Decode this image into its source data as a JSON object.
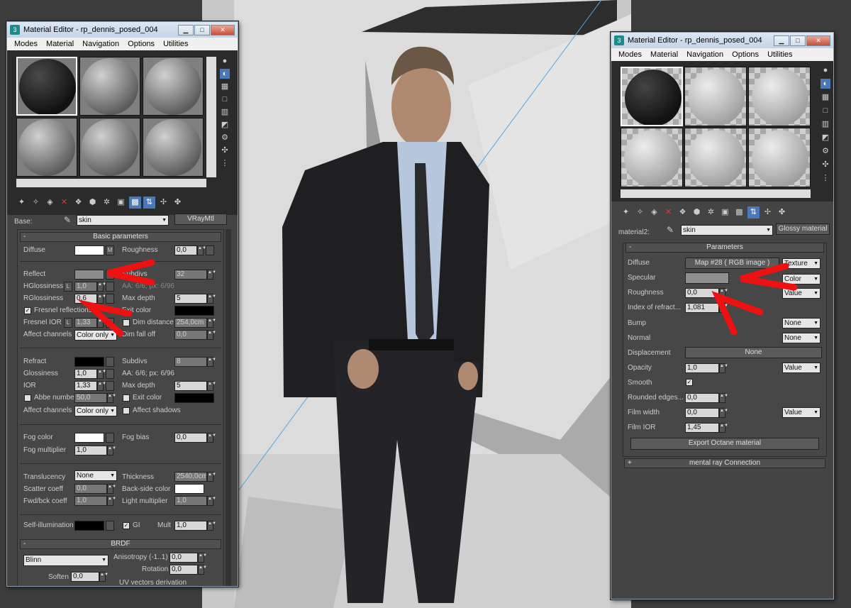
{
  "left_editor": {
    "title": "Material Editor - rp_dennis_posed_004",
    "menu": [
      "Modes",
      "Material",
      "Navigation",
      "Options",
      "Utilities"
    ],
    "base_label": "Base:",
    "material_name": "skin",
    "material_type": "VRayMtl",
    "basic_header": "Basic parameters",
    "diffuse": {
      "label": "Diffuse",
      "map": "M",
      "roughness_label": "Roughness",
      "roughness": "0,0"
    },
    "reflect": {
      "label": "Reflect",
      "subdivs_label": "Subdivs",
      "subdivs": "32",
      "hglossiness_label": "HGlossiness",
      "hglossiness": "1,0",
      "lock": "L",
      "aa": "AA: 6/6; px: 6/96",
      "rglossiness_label": "RGlossiness",
      "rglossiness": "0,6",
      "max_depth_label": "Max depth",
      "max_depth": "5",
      "fresnel_label": "Fresnel reflections",
      "exit_color_label": "Exit color",
      "fresnel_ior_label": "Fresnel IOR",
      "fresnel_ior": "1,33",
      "dim_distance_label": "Dim distance",
      "dim_distance": "254,0cm",
      "affect_channels_label": "Affect channels",
      "affect_channels": "Color only",
      "dim_falloff_label": "Dim fall off",
      "dim_falloff": "0,0"
    },
    "refract": {
      "label": "Refract",
      "subdivs_label": "Subdivs",
      "subdivs": "8",
      "glossiness_label": "Glossiness",
      "glossiness": "1,0",
      "aa": "AA: 6/6; px: 6/96",
      "ior_label": "IOR",
      "ior": "1,33",
      "max_depth_label": "Max depth",
      "max_depth": "5",
      "abbe_label": "Abbe number",
      "abbe": "50,0",
      "exit_color_label": "Exit color",
      "affect_channels_label": "Affect channels",
      "affect_channels": "Color only",
      "affect_shadows_label": "Affect shadows"
    },
    "fog": {
      "color_label": "Fog color",
      "bias_label": "Fog bias",
      "bias": "0,0",
      "multiplier_label": "Fog multiplier",
      "multiplier": "1,0"
    },
    "translucency": {
      "label": "Translucency",
      "value": "None",
      "thickness_label": "Thickness",
      "thickness": "2540,0cm",
      "scatter_label": "Scatter coeff",
      "scatter": "0,0",
      "backside_label": "Back-side color",
      "fwdbck_label": "Fwd/bck coeff",
      "fwdbck": "1,0",
      "light_mult_label": "Light multiplier",
      "light_mult": "1,0"
    },
    "selfillum": {
      "label": "Self-illumination",
      "gi_label": "GI",
      "mult_label": "Mult",
      "mult": "1,0"
    },
    "brdf": {
      "header": "BRDF",
      "type": "Blinn",
      "anisotropy_label": "Anisotropy (-1..1)",
      "anisotropy": "0,0",
      "rotation_label": "Rotation",
      "rotation": "0,0",
      "soften_label": "Soften",
      "soften": "0,0",
      "uv_label": "UV vectors derivation"
    }
  },
  "right_editor": {
    "title": "Material Editor - rp_dennis_posed_004",
    "menu": [
      "Modes",
      "Material",
      "Navigation",
      "Options",
      "Utilities"
    ],
    "base_label": "material2:",
    "material_name": "skin",
    "material_type": "Glossy material",
    "params_header": "Parameters",
    "diffuse": {
      "label": "Diffuse",
      "map": "Map #28  ( RGB image )",
      "mode": "Texture"
    },
    "specular": {
      "label": "Specular",
      "mode": "Color"
    },
    "roughness": {
      "label": "Roughness",
      "value": "0,0",
      "mode": "Value"
    },
    "ior": {
      "label": "Index of refract...",
      "value": "1,081"
    },
    "bump": {
      "label": "Bump",
      "mode": "None"
    },
    "normal": {
      "label": "Normal",
      "mode": "None"
    },
    "displacement": {
      "label": "Displacement",
      "value": "None"
    },
    "opacity": {
      "label": "Opacity",
      "value": "1,0",
      "mode": "Value"
    },
    "smooth": {
      "label": "Smooth"
    },
    "rounded": {
      "label": "Rounded edges...",
      "value": "0,0"
    },
    "film_width": {
      "label": "Film width",
      "value": "0,0",
      "mode": "Value"
    },
    "film_ior": {
      "label": "Film IOR",
      "value": "1,45"
    },
    "export_btn": "Export Octane material",
    "mentalray": "mental ray Connection"
  },
  "colors": {
    "annotation_arrow": "#ee1111",
    "active_button": "#4a78b8"
  }
}
